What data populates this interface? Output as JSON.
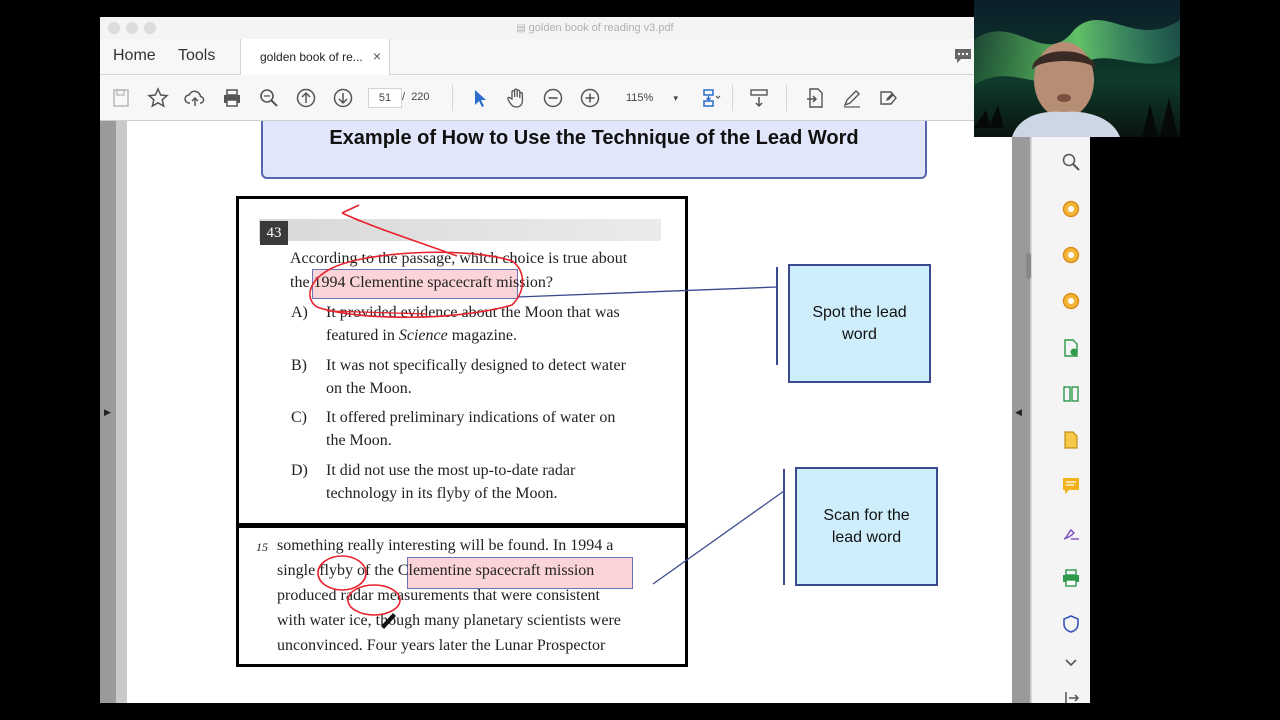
{
  "window": {
    "title": "golden book of reading v3.pdf"
  },
  "nav": {
    "home": "Home",
    "tools": "Tools"
  },
  "tab": {
    "label": "golden book of re...",
    "close": "×"
  },
  "toolbar": {
    "page_current": "51",
    "page_sep": "/",
    "page_total": "220",
    "zoom": "115%",
    "zoom_caret": "▾"
  },
  "page": {
    "header": "Example of How to Use the Technique of the Lead Word",
    "question": {
      "number": "43",
      "line1": "According to the passage, which choice is true about",
      "line2_pre": "the ",
      "line2_hl": "1994 Clementine spacecraft",
      "line2_post": " mission?",
      "options": [
        {
          "letter": "A)",
          "l1": "It provided evidence about the Moon that was",
          "l2a": "featured in ",
          "l2i": "Science",
          "l2b": " magazine."
        },
        {
          "letter": "B)",
          "l1": "It was not specifically designed to detect water",
          "l2a": "on the Moon.",
          "l2i": "",
          "l2b": ""
        },
        {
          "letter": "C)",
          "l1": "It offered preliminary indications of water on",
          "l2a": "the Moon.",
          "l2i": "",
          "l2b": ""
        },
        {
          "letter": "D)",
          "l1": "It did not use the most up-to-date radar",
          "l2a": "technology in its flyby of the Moon.",
          "l2i": "",
          "l2b": ""
        }
      ]
    },
    "passage": {
      "line_no": "15",
      "l1": "something really interesting will be found. In 1994 a",
      "l2_pre": "single ",
      "l2_w1": "flyby",
      "l2_mid": " of the ",
      "l2_hl": "Clementine spacecraft mission",
      "l3_pre": "produced ",
      "l3_w1": "radar",
      "l3_post": " measurements that were consistent",
      "l4": "with water ice, though many planetary scientists were",
      "l5": "unconvinced. Four years later the Lunar Prospector"
    },
    "callouts": {
      "spot": "Spot the lead word",
      "scan": "Scan for the lead word"
    }
  },
  "colors": {
    "highlight": "#fbd4d8",
    "callout_fill": "#cfeefc",
    "annotation_ink": "#e8222e",
    "header_band": "#e2e6fb"
  }
}
